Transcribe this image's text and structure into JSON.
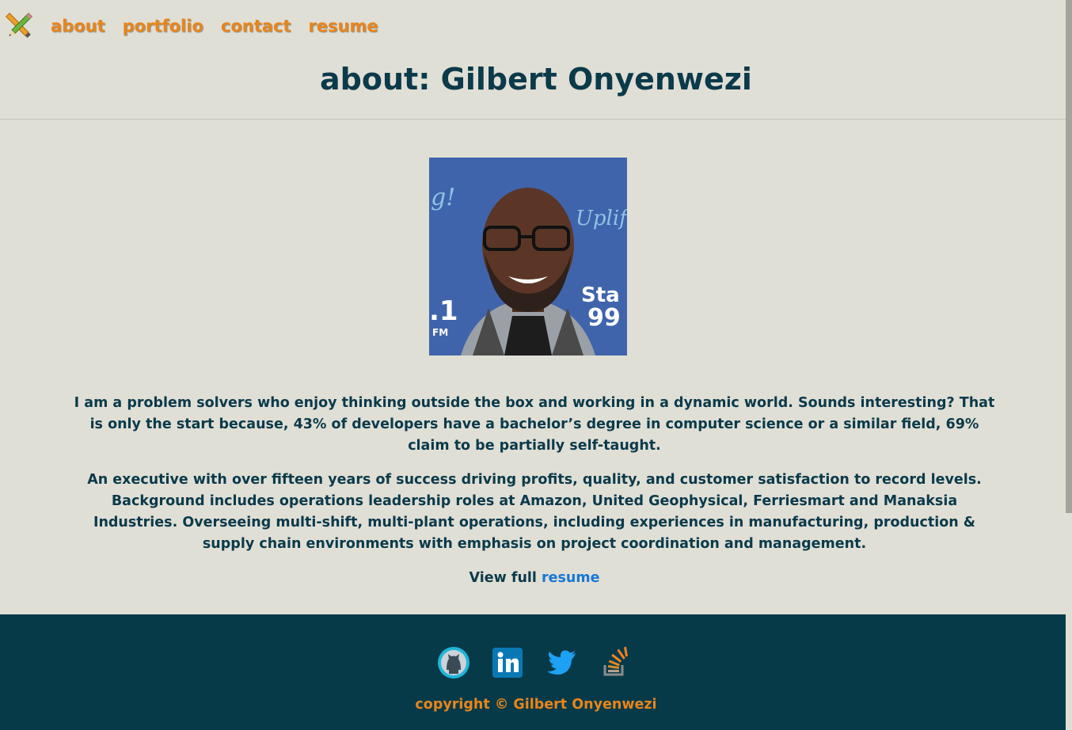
{
  "nav": {
    "items": [
      {
        "label": "about"
      },
      {
        "label": "portfolio"
      },
      {
        "label": "contact"
      },
      {
        "label": "resume"
      }
    ]
  },
  "page": {
    "title": "about: Gilbert Onyenwezi"
  },
  "bio": {
    "paragraph1": "I am a problem solvers who enjoy thinking outside the box and working in a dynamic world. Sounds interesting? That is only the start because, 43% of developers have a bachelor’s degree in computer science or a similar field, 69% claim to be partially self-taught.",
    "paragraph2": "An executive with over fifteen years of success driving profits, quality, and customer satisfaction to record levels. Background includes operations leadership roles at Amazon, United Geophysical, Ferriesmart and Manaksia Industries. Overseeing multi-shift, multi-plant operations, including experiences in manufacturing, production & supply chain environments with emphasis on project coordination and management.",
    "view_prefix": "View full ",
    "resume_link": "resume"
  },
  "footer": {
    "social": [
      {
        "icon": "github-icon"
      },
      {
        "icon": "linkedin-icon"
      },
      {
        "icon": "twitter-icon"
      },
      {
        "icon": "stackoverflow-icon"
      }
    ],
    "copyright": "copyright © Gilbert Onyenwezi"
  },
  "colors": {
    "background": "#e0dfd6",
    "accent": "#e8851a",
    "heading": "#0b3a4a",
    "link": "#1877d4",
    "footer": "#073a49"
  }
}
